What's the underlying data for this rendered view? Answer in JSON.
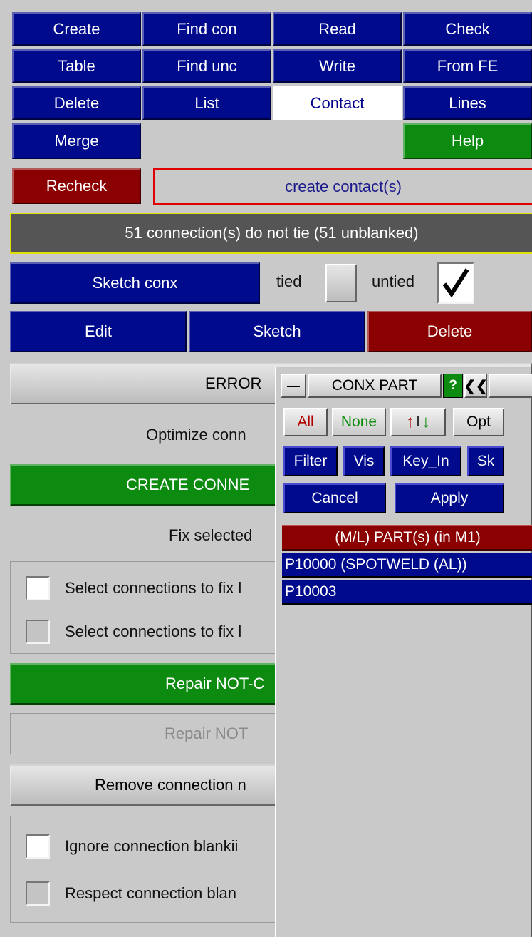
{
  "menu": {
    "create": "Create",
    "find_con": "Find con",
    "read": "Read",
    "check": "Check",
    "table": "Table",
    "find_unc": "Find unc",
    "write": "Write",
    "from_fe": "From FE",
    "delete": "Delete",
    "list": "List",
    "contact": "Contact",
    "lines": "Lines",
    "merge": "Merge",
    "help": "Help"
  },
  "recheck": "Recheck",
  "create_contacts": "create contact(s)",
  "status_message": "51 connection(s) do not tie (51 unblanked)",
  "sketch_row": {
    "sketch_conx": "Sketch conx",
    "tied": "tied",
    "untied": "untied",
    "tied_checked": false,
    "untied_checked": true
  },
  "edit_row": {
    "edit": "Edit",
    "sketch": "Sketch",
    "delete": "Delete"
  },
  "error_button": "ERROR",
  "optimize_label": "Optimize conn",
  "create_connections": "CREATE CONNE",
  "fix_selected": "Fix selected",
  "fix_options": [
    {
      "label": "Select connections to fix l",
      "checked": false
    },
    {
      "label": "Select connections to fix l",
      "checked": false
    }
  ],
  "repair_not_green": "Repair NOT-C",
  "repair_not_gray": "Repair NOT",
  "remove_connection": "Remove connection n",
  "blanking_options": [
    {
      "label": "Ignore connection blankii",
      "checked": false
    },
    {
      "label": "Respect connection blan",
      "checked": false
    }
  ],
  "panel": {
    "minimize": "—",
    "title": "CONX PART",
    "help": "?",
    "collapse": "❮❮",
    "all": "All",
    "none": "None",
    "sort_up": "↑",
    "sort_mid": "I",
    "sort_down": "↓",
    "opt": "Opt",
    "filter": "Filter",
    "vis": "Vis",
    "key_in": "Key_In",
    "sk": "Sk",
    "cancel": "Cancel",
    "apply": "Apply",
    "list_header": "(M/L) PART(s) (in M1)",
    "items": [
      "P10000 (SPOTWELD (AL))",
      "P10003"
    ]
  },
  "colors": {
    "blue": "#000a8c",
    "green": "#0d8b11",
    "red": "#8b0000",
    "status_bg": "#555555",
    "background": "#c9c9c9"
  }
}
